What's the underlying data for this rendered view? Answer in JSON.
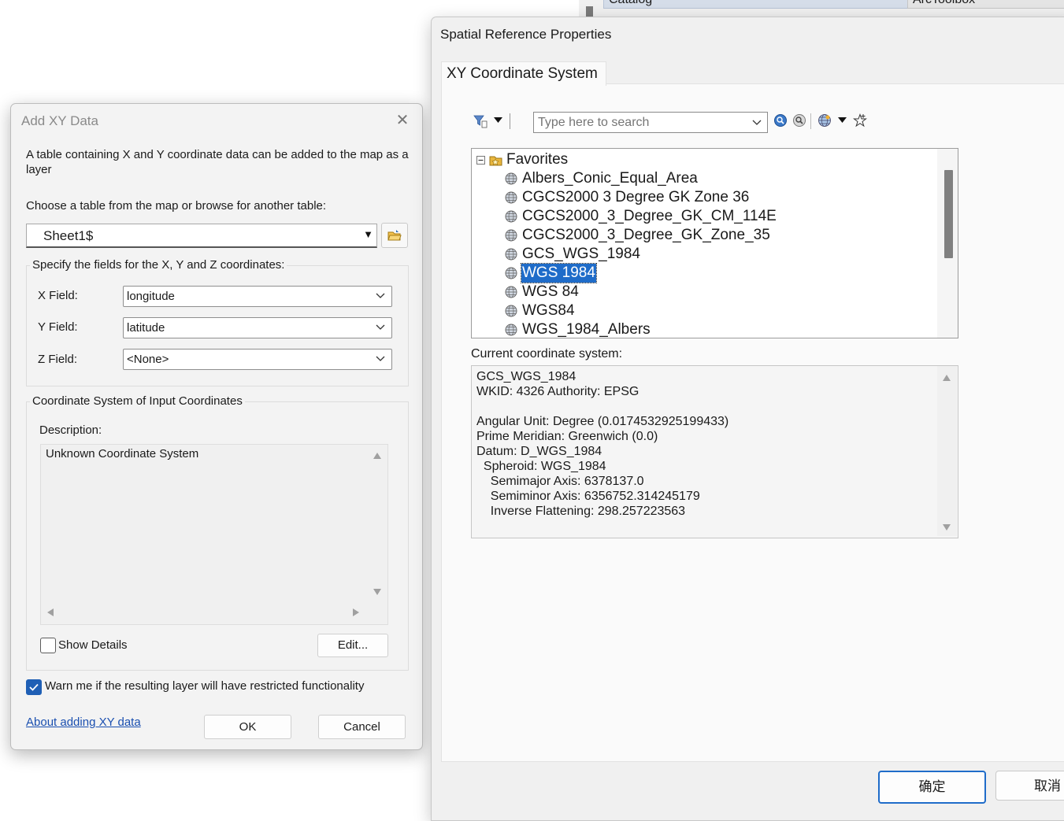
{
  "background": {
    "catalog_tab": "Catalog",
    "toolbox_tab": "ArcToolbox"
  },
  "add_xy": {
    "title": "Add XY Data",
    "intro": "A table containing X and Y coordinate data can be added to the map as a layer",
    "choose_label": "Choose a table from the map or browse for another table:",
    "table_value": "Sheet1$",
    "fields_group": "Specify the fields for the X, Y and Z coordinates:",
    "x_label": "X Field:",
    "x_value": "longitude",
    "y_label": "Y Field:",
    "y_value": "latitude",
    "z_label": "Z Field:",
    "z_value": "<None>",
    "coord_group": "Coordinate System of Input Coordinates",
    "description_label": "Description:",
    "description_value": "Unknown Coordinate System",
    "show_details": "Show Details",
    "show_details_checked": false,
    "edit_button": "Edit...",
    "warn_label": "Warn me if the resulting layer will have restricted functionality",
    "warn_checked": true,
    "about_link": "About adding XY data",
    "ok_button": "OK",
    "cancel_button": "Cancel"
  },
  "spatial_ref": {
    "title": "Spatial Reference Properties",
    "tab": "XY Coordinate System",
    "search_placeholder": "Type here to search",
    "favorites_label": "Favorites",
    "items": [
      "Albers_Conic_Equal_Area",
      "CGCS2000 3 Degree GK Zone 36",
      "CGCS2000_3_Degree_GK_CM_114E",
      "CGCS2000_3_Degree_GK_Zone_35",
      "GCS_WGS_1984",
      "WGS 1984",
      "WGS 84",
      "WGS84",
      "WGS_1984_Albers"
    ],
    "selected_item": "WGS 1984",
    "current_label": "Current coordinate system:",
    "current_lines": [
      "GCS_WGS_1984",
      "WKID: 4326 Authority: EPSG",
      "",
      "Angular Unit: Degree (0.0174532925199433)",
      "Prime Meridian: Greenwich (0.0)",
      "Datum: D_WGS_1984",
      "  Spheroid: WGS_1984",
      "    Semimajor Axis: 6378137.0",
      "    Semiminor Axis: 6356752.314245179",
      "    Inverse Flattening: 298.257223563"
    ],
    "ok_button": "确定",
    "cancel_button": "取消"
  },
  "colors": {
    "accent": "#1f6cc9",
    "checkbox": "#1f5fb5",
    "link": "#1a4fb0"
  }
}
